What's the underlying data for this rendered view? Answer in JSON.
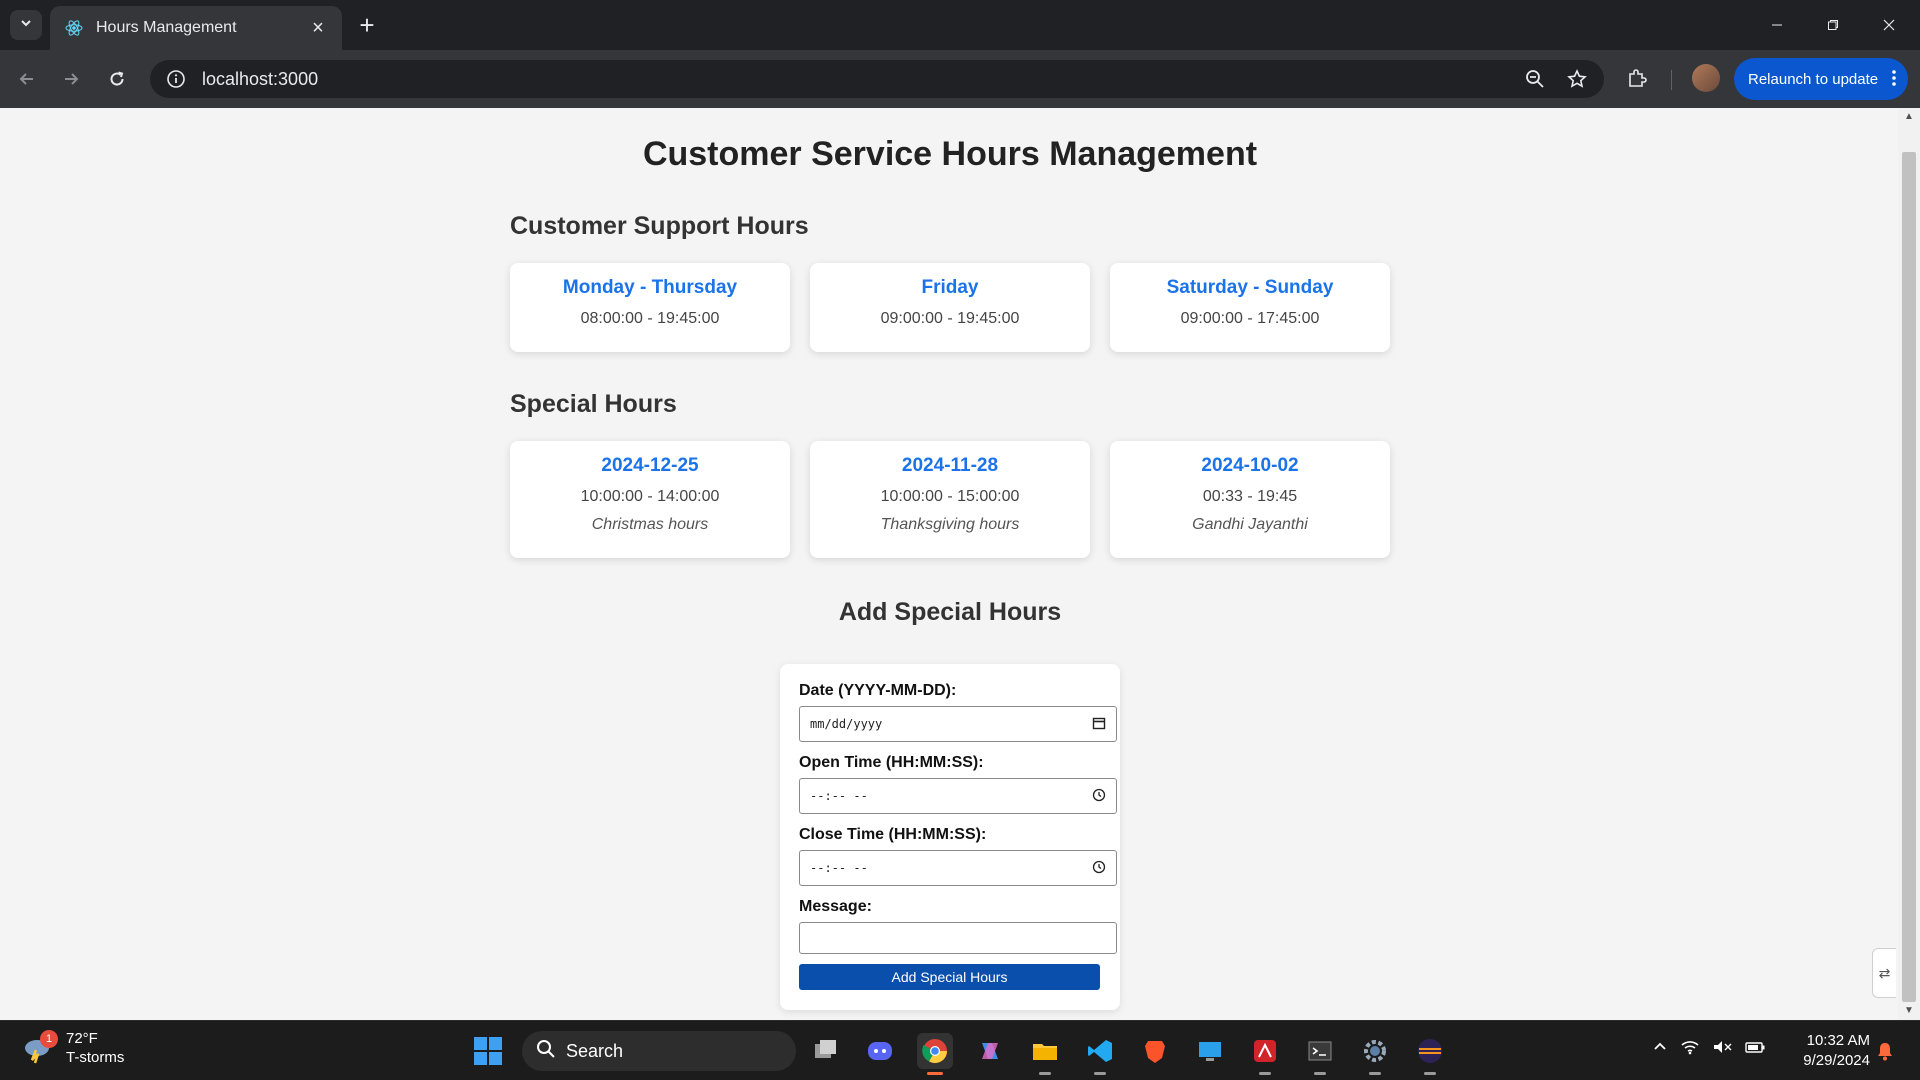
{
  "browser": {
    "tab_title": "Hours Management",
    "url": "localhost:3000",
    "relaunch_label": "Relaunch to update"
  },
  "page": {
    "title": "Customer Service Hours Management",
    "support_section_title": "Customer Support Hours",
    "special_section_title": "Special Hours",
    "support_hours": [
      {
        "days": "Monday - Thursday",
        "time": "08:00:00 - 19:45:00"
      },
      {
        "days": "Friday",
        "time": "09:00:00 - 19:45:00"
      },
      {
        "days": "Saturday - Sunday",
        "time": "09:00:00 - 17:45:00"
      }
    ],
    "special_hours": [
      {
        "date": "2024-12-25",
        "time": "10:00:00 - 14:00:00",
        "message": "Christmas hours"
      },
      {
        "date": "2024-11-28",
        "time": "10:00:00 - 15:00:00",
        "message": "Thanksgiving hours"
      },
      {
        "date": "2024-10-02",
        "time": "00:33 - 19:45",
        "message": "Gandhi Jayanthi"
      }
    ]
  },
  "form": {
    "title": "Add Special Hours",
    "date_label": "Date (YYYY-MM-DD):",
    "date_placeholder": "mm/dd/yyyy",
    "open_label": "Open Time (HH:MM:SS):",
    "open_placeholder": "--:-- --",
    "close_label": "Close Time (HH:MM:SS):",
    "close_placeholder": "--:-- --",
    "message_label": "Message:",
    "message_value": "",
    "submit_label": "Add Special Hours"
  },
  "taskbar": {
    "temperature": "72°F",
    "condition": "T-storms",
    "weather_badge": "1",
    "search_label": "Search",
    "time": "10:32 AM",
    "date": "9/29/2024"
  },
  "colors": {
    "accent_blue": "#1a73e8",
    "button_blue": "#0b4fad",
    "page_bg": "#f4f4f4"
  }
}
